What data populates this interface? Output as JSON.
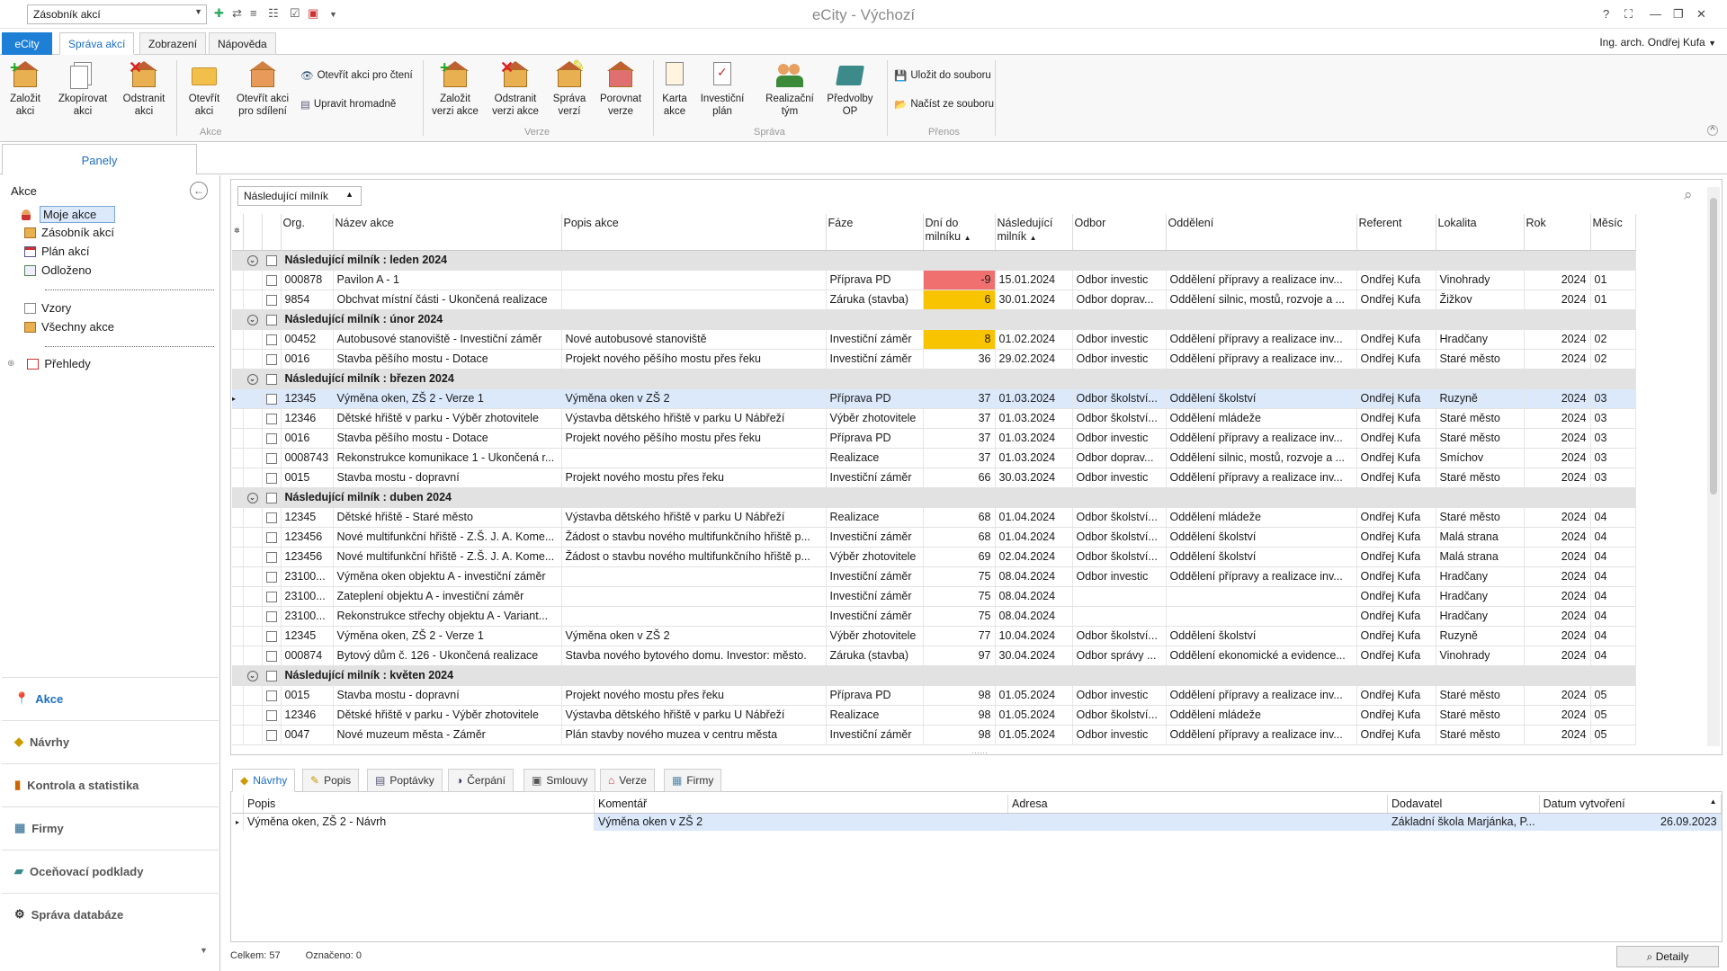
{
  "titlebar": {
    "combo_value": "Zásobník akcí",
    "title": "eCity - Výchozí",
    "controls": [
      "?",
      "⛶",
      "—",
      "❐",
      "✕"
    ]
  },
  "tabs": {
    "app": "eCity",
    "items": [
      "Správa akcí",
      "Zobrazení",
      "Nápověda"
    ],
    "active": "Správa akcí"
  },
  "user": "Ing. arch. Ondřej Kufa",
  "ribbon": {
    "groups": {
      "akce": "Akce",
      "verze": "Verze",
      "sprava": "Správa",
      "prenos": "Přenos"
    },
    "buttons": {
      "zalozit": "Založit akci",
      "zkopirovat": "Zkopírovat akci",
      "odstranit": "Odstranit akci",
      "otevrit": "Otevřít akci",
      "otevrit_sdileni": "Otevřít akci pro sdílení",
      "otevrit_cteni": "Otevřít akci pro čtení",
      "upravit_hromadne": "Upravit hromadně",
      "zalozit_verzi": "Založit verzi akce",
      "odstranit_verzi": "Odstranit verzi akce",
      "sprava_verzi": "Správa verzí",
      "porovnat_verze": "Porovnat verze",
      "karta": "Karta akce",
      "investicni_plan": "Investiční plán",
      "realizacni_tym": "Realizační tým",
      "predvolby": "Předvolby OP",
      "ulozit": "Uložit do souboru",
      "nacist": "Načíst ze souboru"
    }
  },
  "left": {
    "tab": "Panely",
    "header": "Akce",
    "tree": [
      "Moje akce",
      "Zásobník akcí",
      "Plán akcí",
      "Odloženo",
      "Vzory",
      "Všechny akce",
      "Přehledy"
    ],
    "nav": [
      "Akce",
      "Návrhy",
      "Kontrola a statistika",
      "Firmy",
      "Oceňovací podklady",
      "Správa databáze"
    ]
  },
  "grid": {
    "group_by": "Následující milník",
    "columns": [
      "Org.",
      "Název akce",
      "Popis akce",
      "Fáze",
      "Dní do milníku",
      "Následující milník",
      "Odbor",
      "Oddělení",
      "Referent",
      "Lokalita",
      "Rok",
      "Měsíc"
    ],
    "rows": [
      {
        "group": "Následující milník : leden 2024"
      },
      {
        "org": "000878",
        "nazev": "Pavilon A - 1",
        "popis": "",
        "faze": "Příprava PD",
        "dni": "-9",
        "mil": "15.01.2024",
        "odbor": "Odbor investic",
        "odd": "Oddělení přípravy a realizace inv...",
        "ref": "Ondřej Kufa",
        "lok": "Vinohrady",
        "rok": "2024",
        "mes": "01",
        "hl": "red"
      },
      {
        "org": "9854",
        "nazev": "Obchvat místní části - Ukončená realizace",
        "popis": "",
        "faze": "Záruka (stavba)",
        "dni": "6",
        "mil": "30.01.2024",
        "odbor": "Odbor doprav...",
        "odd": "Oddělení silnic, mostů, rozvoje a ...",
        "ref": "Ondřej Kufa",
        "lok": "Žižkov",
        "rok": "2024",
        "mes": "01",
        "hl": "ylw"
      },
      {
        "group": "Následující milník : únor 2024"
      },
      {
        "org": "00452",
        "nazev": "Autobusové stanoviště - Investiční záměr",
        "popis": "Nové autobusové stanoviště",
        "faze": "Investiční záměr",
        "dni": "8",
        "mil": "01.02.2024",
        "odbor": "Odbor investic",
        "odd": "Oddělení přípravy a realizace inv...",
        "ref": "Ondřej Kufa",
        "lok": "Hradčany",
        "rok": "2024",
        "mes": "02",
        "hl": "ylw"
      },
      {
        "org": "0016",
        "nazev": "Stavba pěšího mostu  - Dotace",
        "popis": "Projekt nového pěšího mostu přes řeku",
        "faze": "Investiční záměr",
        "dni": "36",
        "mil": "29.02.2024",
        "odbor": "Odbor investic",
        "odd": "Oddělení přípravy a realizace inv...",
        "ref": "Ondřej Kufa",
        "lok": "Staré město",
        "rok": "2024",
        "mes": "02"
      },
      {
        "group": "Následující milník : březen 2024"
      },
      {
        "org": "12345",
        "nazev": "Výměna oken, ZŠ 2  - Verze 1",
        "popis": "Výměna oken v ZŠ 2",
        "faze": "Příprava PD",
        "dni": "37",
        "mil": "01.03.2024",
        "odbor": "Odbor školství...",
        "odd": "Oddělení školství",
        "ref": "Ondřej Kufa",
        "lok": "Ruzyně",
        "rok": "2024",
        "mes": "03",
        "sel": true
      },
      {
        "org": "12346",
        "nazev": "Dětské hřiště v parku - Výběr zhotovitele",
        "popis": "Výstavba dětského hřiště v parku U Nábřeží",
        "faze": "Výběr zhotovitele",
        "dni": "37",
        "mil": "01.03.2024",
        "odbor": "Odbor školství...",
        "odd": "Oddělení mládeže",
        "ref": "Ondřej Kufa",
        "lok": "Staré město",
        "rok": "2024",
        "mes": "03"
      },
      {
        "org": "0016",
        "nazev": "Stavba pěšího mostu  - Dotace",
        "popis": "Projekt nového pěšího mostu přes řeku",
        "faze": "Příprava PD",
        "dni": "37",
        "mil": "01.03.2024",
        "odbor": "Odbor investic",
        "odd": "Oddělení přípravy a realizace inv...",
        "ref": "Ondřej Kufa",
        "lok": "Staré město",
        "rok": "2024",
        "mes": "03"
      },
      {
        "org": "0008743",
        "nazev": "Rekonstrukce komunikace 1 - Ukončená r...",
        "popis": "",
        "faze": "Realizace",
        "dni": "37",
        "mil": "01.03.2024",
        "odbor": "Odbor doprav...",
        "odd": "Oddělení silnic, mostů, rozvoje a ...",
        "ref": "Ondřej Kufa",
        "lok": "Smíchov",
        "rok": "2024",
        "mes": "03"
      },
      {
        "org": "0015",
        "nazev": "Stavba mostu  - dopravní",
        "popis": "Projekt nového mostu přes řeku",
        "faze": "Investiční záměr",
        "dni": "66",
        "mil": "30.03.2024",
        "odbor": "Odbor investic",
        "odd": "Oddělení přípravy a realizace inv...",
        "ref": "Ondřej Kufa",
        "lok": "Staré město",
        "rok": "2024",
        "mes": "03"
      },
      {
        "group": "Následující milník : duben 2024"
      },
      {
        "org": "12345",
        "nazev": "Dětské hřiště  - Staré město",
        "popis": "Výstavba dětského hřiště v parku U Nábřeží",
        "faze": "Realizace",
        "dni": "68",
        "mil": "01.04.2024",
        "odbor": "Odbor školství...",
        "odd": "Oddělení mládeže",
        "ref": "Ondřej Kufa",
        "lok": "Staré město",
        "rok": "2024",
        "mes": "04"
      },
      {
        "org": "123456",
        "nazev": "Nové multifunkční hřiště - Z.Š. J. A. Kome...",
        "popis": "Žádost o stavbu nového multifunkčního hřiště p...",
        "faze": "Investiční záměr",
        "dni": "68",
        "mil": "01.04.2024",
        "odbor": "Odbor školství...",
        "odd": "Oddělení školství",
        "ref": "Ondřej Kufa",
        "lok": "Malá strana",
        "rok": "2024",
        "mes": "04"
      },
      {
        "org": "123456",
        "nazev": "Nové multifunkční hřiště - Z.Š. J. A. Kome...",
        "popis": "Žádost o stavbu nového multifunkčního hřiště p...",
        "faze": "Výběr zhotovitele",
        "dni": "69",
        "mil": "02.04.2024",
        "odbor": "Odbor školství...",
        "odd": "Oddělení školství",
        "ref": "Ondřej Kufa",
        "lok": "Malá strana",
        "rok": "2024",
        "mes": "04"
      },
      {
        "org": "23100...",
        "nazev": "Výměna oken objektu A - investiční záměr",
        "popis": "",
        "faze": "Investiční záměr",
        "dni": "75",
        "mil": "08.04.2024",
        "odbor": "Odbor investic",
        "odd": "Oddělení přípravy a realizace inv...",
        "ref": "Ondřej Kufa",
        "lok": "Hradčany",
        "rok": "2024",
        "mes": "04"
      },
      {
        "org": "23100...",
        "nazev": "Zateplení objektu A - investiční záměr",
        "popis": "",
        "faze": "Investiční záměr",
        "dni": "75",
        "mil": "08.04.2024",
        "odbor": "",
        "odd": "",
        "ref": "Ondřej Kufa",
        "lok": "Hradčany",
        "rok": "2024",
        "mes": "04"
      },
      {
        "org": "23100...",
        "nazev": "Rekonstrukce střechy objektu A - Variant...",
        "popis": "",
        "faze": "Investiční záměr",
        "dni": "75",
        "mil": "08.04.2024",
        "odbor": "",
        "odd": "",
        "ref": "Ondřej Kufa",
        "lok": "Hradčany",
        "rok": "2024",
        "mes": "04"
      },
      {
        "org": "12345",
        "nazev": "Výměna oken, ZŠ 2  - Verze 1",
        "popis": "Výměna oken v ZŠ 2",
        "faze": "Výběr zhotovitele",
        "dni": "77",
        "mil": "10.04.2024",
        "odbor": "Odbor školství...",
        "odd": "Oddělení školství",
        "ref": "Ondřej Kufa",
        "lok": "Ruzyně",
        "rok": "2024",
        "mes": "04"
      },
      {
        "org": "000874",
        "nazev": "Bytový dům č. 126 - Ukončená realizace",
        "popis": "Stavba nového bytového domu. Investor: město.",
        "faze": "Záruka (stavba)",
        "dni": "97",
        "mil": "30.04.2024",
        "odbor": "Odbor správy ...",
        "odd": "Oddělení ekonomické a evidence...",
        "ref": "Ondřej Kufa",
        "lok": "Vinohrady",
        "rok": "2024",
        "mes": "04"
      },
      {
        "group": "Následující milník : květen 2024"
      },
      {
        "org": "0015",
        "nazev": "Stavba mostu  - dopravní",
        "popis": "Projekt nového mostu přes řeku",
        "faze": "Příprava PD",
        "dni": "98",
        "mil": "01.05.2024",
        "odbor": "Odbor investic",
        "odd": "Oddělení přípravy a realizace inv...",
        "ref": "Ondřej Kufa",
        "lok": "Staré město",
        "rok": "2024",
        "mes": "05"
      },
      {
        "org": "12346",
        "nazev": "Dětské hřiště v parku - Výběr zhotovitele",
        "popis": "Výstavba dětského hřiště v parku U Nábřeží",
        "faze": "Realizace",
        "dni": "98",
        "mil": "01.05.2024",
        "odbor": "Odbor školství...",
        "odd": "Oddělení mládeže",
        "ref": "Ondřej Kufa",
        "lok": "Staré město",
        "rok": "2024",
        "mes": "05"
      },
      {
        "org": "0047",
        "nazev": "Nové muzeum města - Záměr",
        "popis": "Plán stavby nového muzea v centru města",
        "faze": "Investiční záměr",
        "dni": "98",
        "mil": "01.05.2024",
        "odbor": "Odbor investic",
        "odd": "Oddělení přípravy a realizace inv...",
        "ref": "Ondřej Kufa",
        "lok": "Staré město",
        "rok": "2024",
        "mes": "05"
      }
    ]
  },
  "bottom": {
    "tabs": [
      "Návrhy",
      "Popis",
      "Poptávky",
      "Čerpání",
      "Smlouvy",
      "Verze",
      "Firmy"
    ],
    "active": "Návrhy",
    "columns": [
      "Popis",
      "Komentář",
      "Adresa",
      "Dodavatel",
      "Datum vytvoření"
    ],
    "rows": [
      {
        "popis": "Výměna oken, ZŠ 2 - Návrh",
        "komentar": "Výměna oken v ZŠ 2",
        "adresa": "",
        "dodavatel": "Základní škola Marjánka, P...",
        "datum": "26.09.2023"
      }
    ]
  },
  "status": {
    "celkem": "Celkem: 57",
    "oznaceno": "Označeno: 0",
    "detail": "Detaily"
  },
  "colors": {
    "accent": "#1d7fd6",
    "selection": "#dbe9fb",
    "red": "#f07070",
    "yellow": "#f8c400",
    "group": "#e2e2e2"
  }
}
